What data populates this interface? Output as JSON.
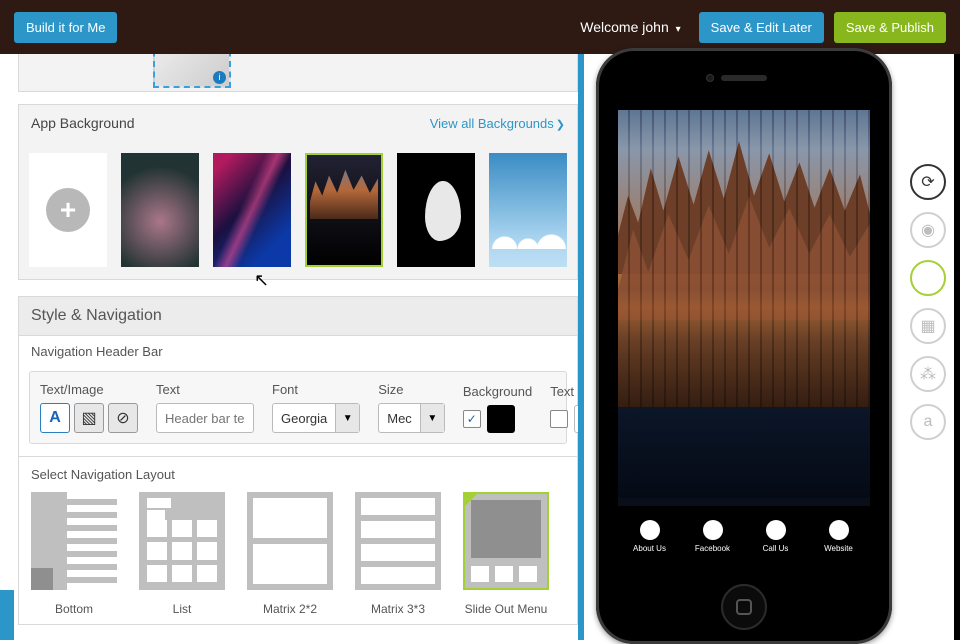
{
  "topbar": {
    "build_label": "Build it for Me",
    "welcome_prefix": "Welcome ",
    "username": "john",
    "save_edit_label": "Save & Edit Later",
    "publish_label": "Save & Publish"
  },
  "background_section": {
    "title": "App Background",
    "view_all_label": "View all Backgrounds",
    "items": [
      {
        "type": "add"
      },
      {
        "type": "thumb-planet"
      },
      {
        "type": "thumb-neon"
      },
      {
        "type": "thumb-city",
        "selected": true
      },
      {
        "type": "thumb-face"
      },
      {
        "type": "thumb-sky"
      }
    ]
  },
  "style_nav": {
    "heading": "Style & Navigation",
    "subheading": "Navigation Header Bar",
    "textimage_label": "Text/Image",
    "text_label": "Text",
    "text_placeholder": "Header bar text",
    "text_value": "",
    "font_label": "Font",
    "font_value": "Georgia",
    "size_label": "Size",
    "size_value": "Mec",
    "background_label": "Background",
    "background_checked": true,
    "background_color": "#000000",
    "textcolor_label": "Text",
    "textcolor_checked": false,
    "textcolor_value": "#fff"
  },
  "layout_section": {
    "title": "Select Navigation Layout",
    "layouts": [
      {
        "id": "bottom",
        "label": "Bottom"
      },
      {
        "id": "list",
        "label": "List"
      },
      {
        "id": "m22",
        "label": "Matrix 2*2"
      },
      {
        "id": "m33",
        "label": "Matrix 3*3"
      },
      {
        "id": "slide",
        "label": "Slide Out Menu",
        "selected": true
      }
    ]
  },
  "preview_tabs": [
    {
      "label": "About Us"
    },
    {
      "label": "Facebook"
    },
    {
      "label": "Call Us"
    },
    {
      "label": "Website"
    }
  ],
  "side_icons": [
    {
      "name": "refresh-icon",
      "style": "dark"
    },
    {
      "name": "android-icon"
    },
    {
      "name": "apple-icon",
      "active": true
    },
    {
      "name": "windows-icon"
    },
    {
      "name": "blackberry-icon"
    },
    {
      "name": "amazon-icon"
    }
  ]
}
